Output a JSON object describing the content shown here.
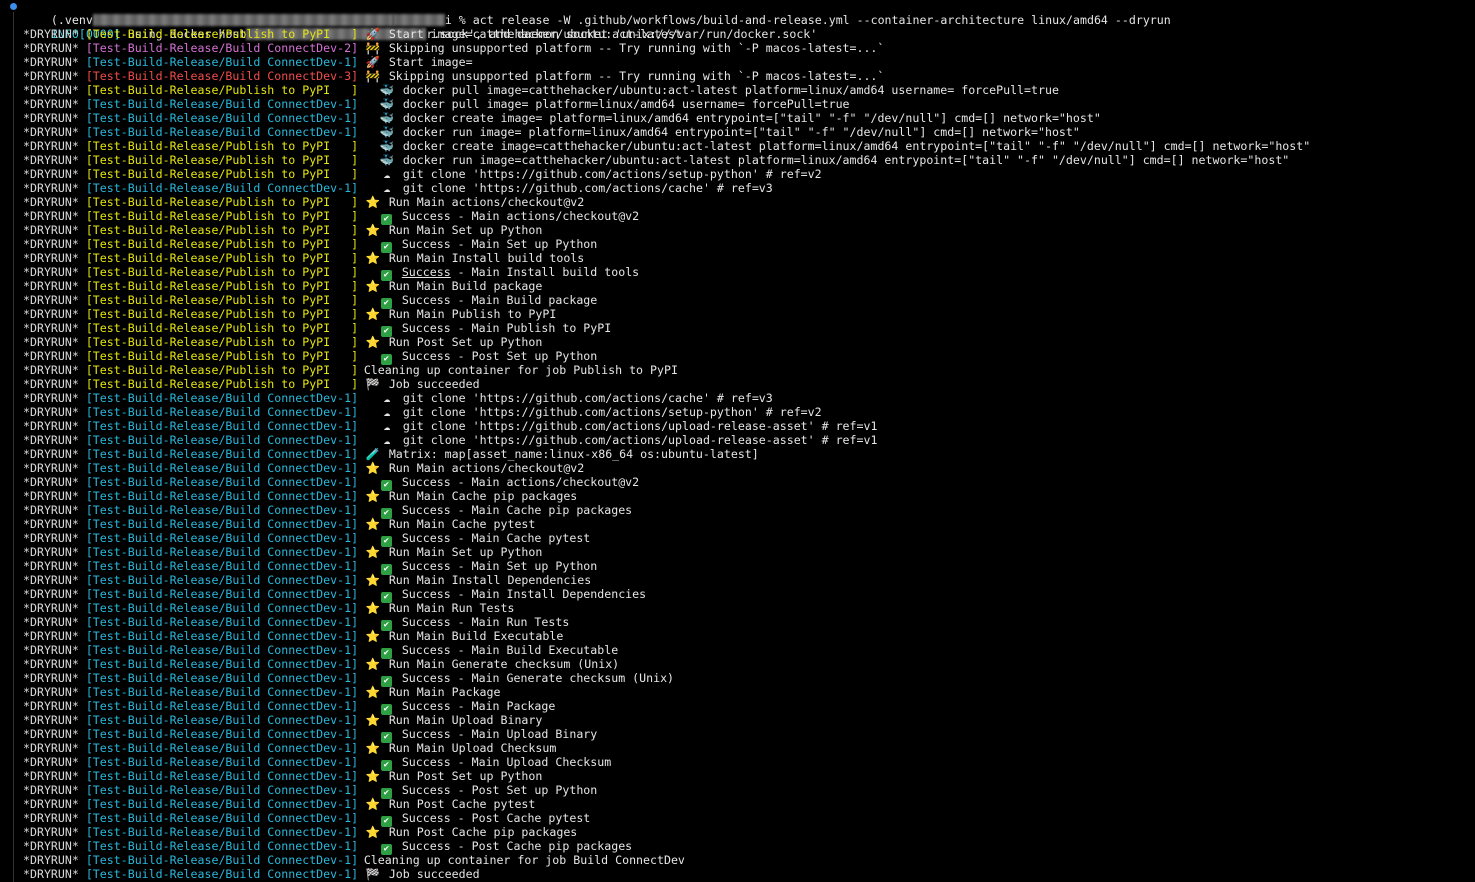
{
  "prompt": {
    "prefix": "(.venv",
    "suffix": "i % act release -W .github/workflows/build-and-release.yml --container-architecture linux/amd64 --dryrun"
  },
  "info_line": {
    "tag": "INFO[0000]",
    "text_a": "using docker host",
    "text_b": "r.sock', and daemon socket 'unix:///var/run/docker.sock'"
  },
  "dryrun_tag": "*DRYRUN*",
  "jobs": {
    "publish": "[Test-Build-Release/Publish to PyPI   ]",
    "connect2": "[Test-Build-Release/Build ConnectDev-2]",
    "connect1": "[Test-Build-Release/Build ConnectDev-1]",
    "connect3": "[Test-Build-Release/Build ConnectDev-3]"
  },
  "lines": [
    {
      "job": "publish",
      "color": "yellow",
      "icon": "rocket-icon",
      "glyph": "🚀",
      "indent": 0,
      "text": "Start image=catthehacker/ubuntu:act-latest"
    },
    {
      "job": "connect2",
      "color": "magenta",
      "icon": "construction-icon",
      "glyph": "🚧",
      "indent": 0,
      "text": "Skipping unsupported platform -- Try running with `-P macos-latest=...`"
    },
    {
      "job": "connect1",
      "color": "cyan",
      "icon": "rocket-icon",
      "glyph": "🚀",
      "indent": 0,
      "text": "Start image="
    },
    {
      "job": "connect3",
      "color": "red",
      "icon": "construction-icon",
      "glyph": "🚧",
      "indent": 0,
      "text": "Skipping unsupported platform -- Try running with `-P macos-latest=...`"
    },
    {
      "job": "publish",
      "color": "yellow",
      "icon": "docker-icon",
      "glyph": "🐳",
      "indent": 1,
      "text": "docker pull image=catthehacker/ubuntu:act-latest platform=linux/amd64 username= forcePull=true"
    },
    {
      "job": "connect1",
      "color": "cyan",
      "icon": "docker-icon",
      "glyph": "🐳",
      "indent": 1,
      "text": "docker pull image= platform=linux/amd64 username= forcePull=true"
    },
    {
      "job": "connect1",
      "color": "cyan",
      "icon": "docker-icon",
      "glyph": "🐳",
      "indent": 1,
      "text": "docker create image= platform=linux/amd64 entrypoint=[\"tail\" \"-f\" \"/dev/null\"] cmd=[] network=\"host\""
    },
    {
      "job": "connect1",
      "color": "cyan",
      "icon": "docker-icon",
      "glyph": "🐳",
      "indent": 1,
      "text": "docker run image= platform=linux/amd64 entrypoint=[\"tail\" \"-f\" \"/dev/null\"] cmd=[] network=\"host\""
    },
    {
      "job": "publish",
      "color": "yellow",
      "icon": "docker-icon",
      "glyph": "🐳",
      "indent": 1,
      "text": "docker create image=catthehacker/ubuntu:act-latest platform=linux/amd64 entrypoint=[\"tail\" \"-f\" \"/dev/null\"] cmd=[] network=\"host\""
    },
    {
      "job": "publish",
      "color": "yellow",
      "icon": "docker-icon",
      "glyph": "🐳",
      "indent": 1,
      "text": "docker run image=catthehacker/ubuntu:act-latest platform=linux/amd64 entrypoint=[\"tail\" \"-f\" \"/dev/null\"] cmd=[] network=\"host\""
    },
    {
      "job": "publish",
      "color": "yellow",
      "icon": "clone-icon",
      "glyph": "☁",
      "indent": 1,
      "text": "git clone 'https://github.com/actions/setup-python' # ref=v2"
    },
    {
      "job": "connect1",
      "color": "cyan",
      "icon": "clone-icon",
      "glyph": "☁",
      "indent": 1,
      "text": "git clone 'https://github.com/actions/cache' # ref=v3"
    },
    {
      "job": "publish",
      "color": "yellow",
      "icon": "star-icon",
      "glyph": "⭐",
      "indent": 0,
      "text": "Run Main actions/checkout@v2"
    },
    {
      "job": "publish",
      "color": "yellow",
      "icon": "check-icon",
      "glyph": "✔",
      "indent": 1,
      "text": "Success - Main actions/checkout@v2"
    },
    {
      "job": "publish",
      "color": "yellow",
      "icon": "star-icon",
      "glyph": "⭐",
      "indent": 0,
      "text": "Run Main Set up Python"
    },
    {
      "job": "publish",
      "color": "yellow",
      "icon": "check-icon",
      "glyph": "✔",
      "indent": 1,
      "text": "Success - Main Set up Python"
    },
    {
      "job": "publish",
      "color": "yellow",
      "icon": "star-icon",
      "glyph": "⭐",
      "indent": 0,
      "text": "Run Main Install build tools"
    },
    {
      "job": "publish",
      "color": "yellow",
      "icon": "check-icon",
      "glyph": "✔",
      "indent": 1,
      "text": "Success - Main Install build tools",
      "underline_first": "Success"
    },
    {
      "job": "publish",
      "color": "yellow",
      "icon": "star-icon",
      "glyph": "⭐",
      "indent": 0,
      "text": "Run Main Build package"
    },
    {
      "job": "publish",
      "color": "yellow",
      "icon": "check-icon",
      "glyph": "✔",
      "indent": 1,
      "text": "Success - Main Build package"
    },
    {
      "job": "publish",
      "color": "yellow",
      "icon": "star-icon",
      "glyph": "⭐",
      "indent": 0,
      "text": "Run Main Publish to PyPI"
    },
    {
      "job": "publish",
      "color": "yellow",
      "icon": "check-icon",
      "glyph": "✔",
      "indent": 1,
      "text": "Success - Main Publish to PyPI"
    },
    {
      "job": "publish",
      "color": "yellow",
      "icon": "star-icon",
      "glyph": "⭐",
      "indent": 0,
      "text": "Run Post Set up Python"
    },
    {
      "job": "publish",
      "color": "yellow",
      "icon": "check-icon",
      "glyph": "✔",
      "indent": 1,
      "text": "Success - Post Set up Python"
    },
    {
      "job": "publish",
      "color": "yellow",
      "icon": "",
      "glyph": "",
      "indent": 0,
      "text": "Cleaning up container for job Publish to PyPI"
    },
    {
      "job": "publish",
      "color": "yellow",
      "icon": "flag-icon",
      "glyph": "🏁",
      "indent": 0,
      "text": "Job succeeded"
    },
    {
      "job": "connect1",
      "color": "cyan",
      "icon": "clone-icon",
      "glyph": "☁",
      "indent": 1,
      "text": "git clone 'https://github.com/actions/cache' # ref=v3"
    },
    {
      "job": "connect1",
      "color": "cyan",
      "icon": "clone-icon",
      "glyph": "☁",
      "indent": 1,
      "text": "git clone 'https://github.com/actions/setup-python' # ref=v2"
    },
    {
      "job": "connect1",
      "color": "cyan",
      "icon": "clone-icon",
      "glyph": "☁",
      "indent": 1,
      "text": "git clone 'https://github.com/actions/upload-release-asset' # ref=v1"
    },
    {
      "job": "connect1",
      "color": "cyan",
      "icon": "clone-icon",
      "glyph": "☁",
      "indent": 1,
      "text": "git clone 'https://github.com/actions/upload-release-asset' # ref=v1"
    },
    {
      "job": "connect1",
      "color": "cyan",
      "icon": "matrix-icon",
      "glyph": "🧪",
      "indent": 0,
      "text": "Matrix: map[asset_name:linux-x86_64 os:ubuntu-latest]"
    },
    {
      "job": "connect1",
      "color": "cyan",
      "icon": "star-icon",
      "glyph": "⭐",
      "indent": 0,
      "text": "Run Main actions/checkout@v2"
    },
    {
      "job": "connect1",
      "color": "cyan",
      "icon": "check-icon",
      "glyph": "✔",
      "indent": 1,
      "text": "Success - Main actions/checkout@v2"
    },
    {
      "job": "connect1",
      "color": "cyan",
      "icon": "star-icon",
      "glyph": "⭐",
      "indent": 0,
      "text": "Run Main Cache pip packages"
    },
    {
      "job": "connect1",
      "color": "cyan",
      "icon": "check-icon",
      "glyph": "✔",
      "indent": 1,
      "text": "Success - Main Cache pip packages"
    },
    {
      "job": "connect1",
      "color": "cyan",
      "icon": "star-icon",
      "glyph": "⭐",
      "indent": 0,
      "text": "Run Main Cache pytest"
    },
    {
      "job": "connect1",
      "color": "cyan",
      "icon": "check-icon",
      "glyph": "✔",
      "indent": 1,
      "text": "Success - Main Cache pytest"
    },
    {
      "job": "connect1",
      "color": "cyan",
      "icon": "star-icon",
      "glyph": "⭐",
      "indent": 0,
      "text": "Run Main Set up Python"
    },
    {
      "job": "connect1",
      "color": "cyan",
      "icon": "check-icon",
      "glyph": "✔",
      "indent": 1,
      "text": "Success - Main Set up Python"
    },
    {
      "job": "connect1",
      "color": "cyan",
      "icon": "star-icon",
      "glyph": "⭐",
      "indent": 0,
      "text": "Run Main Install Dependencies"
    },
    {
      "job": "connect1",
      "color": "cyan",
      "icon": "check-icon",
      "glyph": "✔",
      "indent": 1,
      "text": "Success - Main Install Dependencies"
    },
    {
      "job": "connect1",
      "color": "cyan",
      "icon": "star-icon",
      "glyph": "⭐",
      "indent": 0,
      "text": "Run Main Run Tests"
    },
    {
      "job": "connect1",
      "color": "cyan",
      "icon": "check-icon",
      "glyph": "✔",
      "indent": 1,
      "text": "Success - Main Run Tests"
    },
    {
      "job": "connect1",
      "color": "cyan",
      "icon": "star-icon",
      "glyph": "⭐",
      "indent": 0,
      "text": "Run Main Build Executable"
    },
    {
      "job": "connect1",
      "color": "cyan",
      "icon": "check-icon",
      "glyph": "✔",
      "indent": 1,
      "text": "Success - Main Build Executable"
    },
    {
      "job": "connect1",
      "color": "cyan",
      "icon": "star-icon",
      "glyph": "⭐",
      "indent": 0,
      "text": "Run Main Generate checksum (Unix)"
    },
    {
      "job": "connect1",
      "color": "cyan",
      "icon": "check-icon",
      "glyph": "✔",
      "indent": 1,
      "text": "Success - Main Generate checksum (Unix)"
    },
    {
      "job": "connect1",
      "color": "cyan",
      "icon": "star-icon",
      "glyph": "⭐",
      "indent": 0,
      "text": "Run Main Package"
    },
    {
      "job": "connect1",
      "color": "cyan",
      "icon": "check-icon",
      "glyph": "✔",
      "indent": 1,
      "text": "Success - Main Package"
    },
    {
      "job": "connect1",
      "color": "cyan",
      "icon": "star-icon",
      "glyph": "⭐",
      "indent": 0,
      "text": "Run Main Upload Binary"
    },
    {
      "job": "connect1",
      "color": "cyan",
      "icon": "check-icon",
      "glyph": "✔",
      "indent": 1,
      "text": "Success - Main Upload Binary"
    },
    {
      "job": "connect1",
      "color": "cyan",
      "icon": "star-icon",
      "glyph": "⭐",
      "indent": 0,
      "text": "Run Main Upload Checksum"
    },
    {
      "job": "connect1",
      "color": "cyan",
      "icon": "check-icon",
      "glyph": "✔",
      "indent": 1,
      "text": "Success - Main Upload Checksum"
    },
    {
      "job": "connect1",
      "color": "cyan",
      "icon": "star-icon",
      "glyph": "⭐",
      "indent": 0,
      "text": "Run Post Set up Python"
    },
    {
      "job": "connect1",
      "color": "cyan",
      "icon": "check-icon",
      "glyph": "✔",
      "indent": 1,
      "text": "Success - Post Set up Python"
    },
    {
      "job": "connect1",
      "color": "cyan",
      "icon": "star-icon",
      "glyph": "⭐",
      "indent": 0,
      "text": "Run Post Cache pytest"
    },
    {
      "job": "connect1",
      "color": "cyan",
      "icon": "check-icon",
      "glyph": "✔",
      "indent": 1,
      "text": "Success - Post Cache pytest"
    },
    {
      "job": "connect1",
      "color": "cyan",
      "icon": "star-icon",
      "glyph": "⭐",
      "indent": 0,
      "text": "Run Post Cache pip packages"
    },
    {
      "job": "connect1",
      "color": "cyan",
      "icon": "check-icon",
      "glyph": "✔",
      "indent": 1,
      "text": "Success - Post Cache pip packages"
    },
    {
      "job": "connect1",
      "color": "cyan",
      "icon": "",
      "glyph": "",
      "indent": 0,
      "text": "Cleaning up container for job Build ConnectDev"
    },
    {
      "job": "connect1",
      "color": "cyan",
      "icon": "flag-icon",
      "glyph": "🏁",
      "indent": 0,
      "text": "Job succeeded"
    }
  ],
  "colors": {
    "background": "#000000",
    "yellow": "#e5e510",
    "magenta": "#d670d6",
    "cyan": "#29b8db",
    "red": "#f14c4c"
  }
}
